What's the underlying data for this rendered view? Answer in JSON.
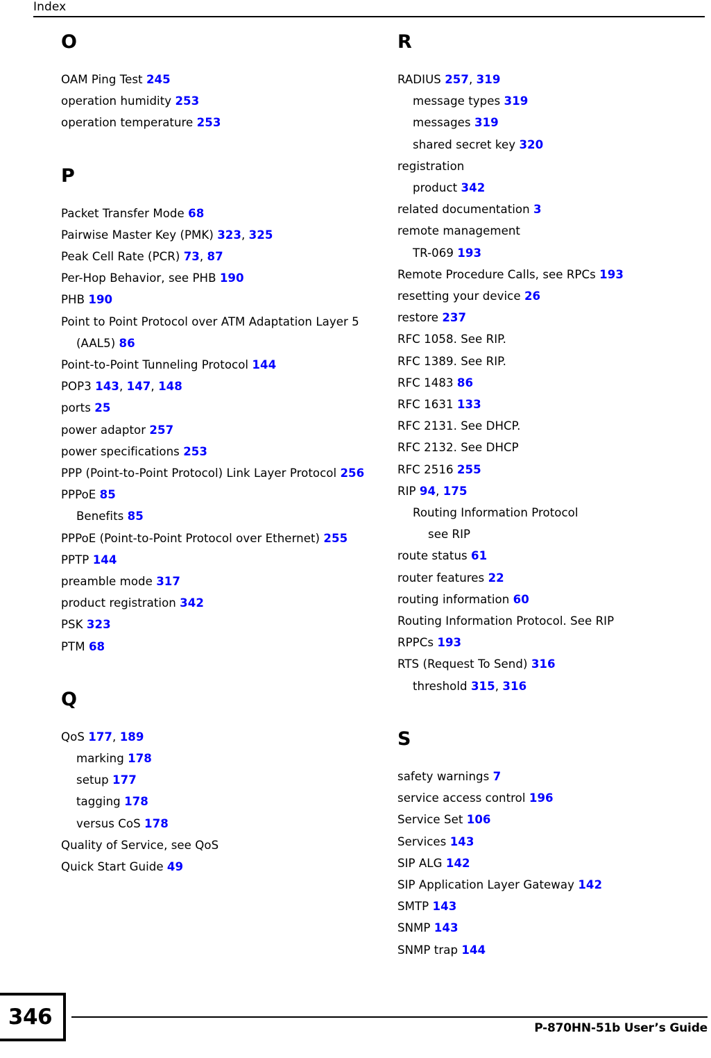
{
  "header": {
    "title": "Index"
  },
  "footer": {
    "page_number": "346",
    "guide_title": "P-870HN-51b User’s Guide"
  },
  "colors": {
    "page_reference": "#0000ff",
    "text": "#000000",
    "background": "#ffffff"
  },
  "columns": [
    {
      "name": "left",
      "sections": [
        {
          "letter": "O",
          "entries": [
            {
              "level": 0,
              "text": "OAM Ping Test ",
              "pages": [
                "245"
              ]
            },
            {
              "level": 0,
              "text": "operation humidity ",
              "pages": [
                "253"
              ]
            },
            {
              "level": 0,
              "text": "operation temperature ",
              "pages": [
                "253"
              ]
            }
          ]
        },
        {
          "letter": "P",
          "entries": [
            {
              "level": 0,
              "text": "Packet Transfer Mode ",
              "pages": [
                "68"
              ]
            },
            {
              "level": 0,
              "text": "Pairwise Master Key (PMK) ",
              "pages": [
                "323",
                "325"
              ]
            },
            {
              "level": 0,
              "text": "Peak Cell Rate (PCR) ",
              "pages": [
                "73",
                "87"
              ]
            },
            {
              "level": 0,
              "text": "Per-Hop Behavior, see PHB ",
              "pages": [
                "190"
              ]
            },
            {
              "level": 0,
              "text": "PHB ",
              "pages": [
                "190"
              ]
            },
            {
              "level": 0,
              "text": "Point to Point Protocol over ATM Adaptation Layer 5 (AAL5) ",
              "pages": [
                "86"
              ]
            },
            {
              "level": 0,
              "text": "Point-to-Point Tunneling Protocol ",
              "pages": [
                "144"
              ]
            },
            {
              "level": 0,
              "text": "POP3 ",
              "pages": [
                "143",
                "147",
                "148"
              ]
            },
            {
              "level": 0,
              "text": "ports ",
              "pages": [
                "25"
              ]
            },
            {
              "level": 0,
              "text": "power adaptor ",
              "pages": [
                "257"
              ]
            },
            {
              "level": 0,
              "text": "power specifications ",
              "pages": [
                "253"
              ]
            },
            {
              "level": 0,
              "text": "PPP (Point-to-Point Protocol) Link Layer Protocol ",
              "pages": [
                "256"
              ]
            },
            {
              "level": 0,
              "text": "PPPoE ",
              "pages": [
                "85"
              ]
            },
            {
              "level": 1,
              "text": "Benefits ",
              "pages": [
                "85"
              ]
            },
            {
              "level": 0,
              "text": "PPPoE (Point-to-Point Protocol over Ethernet) ",
              "pages": [
                "255"
              ]
            },
            {
              "level": 0,
              "text": "PPTP ",
              "pages": [
                "144"
              ]
            },
            {
              "level": 0,
              "text": "preamble mode ",
              "pages": [
                "317"
              ]
            },
            {
              "level": 0,
              "text": "product registration ",
              "pages": [
                "342"
              ]
            },
            {
              "level": 0,
              "text": "PSK ",
              "pages": [
                "323"
              ]
            },
            {
              "level": 0,
              "text": "PTM ",
              "pages": [
                "68"
              ]
            }
          ]
        },
        {
          "letter": "Q",
          "entries": [
            {
              "level": 0,
              "text": "QoS ",
              "pages": [
                "177",
                "189"
              ]
            },
            {
              "level": 1,
              "text": "marking ",
              "pages": [
                "178"
              ]
            },
            {
              "level": 1,
              "text": "setup ",
              "pages": [
                "177"
              ]
            },
            {
              "level": 1,
              "text": "tagging ",
              "pages": [
                "178"
              ]
            },
            {
              "level": 1,
              "text": "versus CoS ",
              "pages": [
                "178"
              ]
            },
            {
              "level": 0,
              "text": "Quality of Service, see QoS",
              "pages": []
            },
            {
              "level": 0,
              "text": "Quick Start Guide ",
              "pages": [
                "49"
              ]
            }
          ]
        }
      ]
    },
    {
      "name": "right",
      "sections": [
        {
          "letter": "R",
          "entries": [
            {
              "level": 0,
              "text": "RADIUS ",
              "pages": [
                "257",
                "319"
              ]
            },
            {
              "level": 1,
              "text": "message types ",
              "pages": [
                "319"
              ]
            },
            {
              "level": 1,
              "text": "messages ",
              "pages": [
                "319"
              ]
            },
            {
              "level": 1,
              "text": "shared secret key ",
              "pages": [
                "320"
              ]
            },
            {
              "level": 0,
              "text": "registration",
              "pages": []
            },
            {
              "level": 1,
              "text": "product ",
              "pages": [
                "342"
              ]
            },
            {
              "level": 0,
              "text": "related documentation ",
              "pages": [
                "3"
              ]
            },
            {
              "level": 0,
              "text": "remote management",
              "pages": []
            },
            {
              "level": 1,
              "text": "TR-069 ",
              "pages": [
                "193"
              ]
            },
            {
              "level": 0,
              "text": "Remote Procedure Calls, see RPCs ",
              "pages": [
                "193"
              ]
            },
            {
              "level": 0,
              "text": "resetting your device ",
              "pages": [
                "26"
              ]
            },
            {
              "level": 0,
              "text": "restore ",
              "pages": [
                "237"
              ]
            },
            {
              "level": 0,
              "text": "RFC 1058. See RIP.",
              "pages": []
            },
            {
              "level": 0,
              "text": "RFC 1389. See RIP.",
              "pages": []
            },
            {
              "level": 0,
              "text": "RFC 1483 ",
              "pages": [
                "86"
              ]
            },
            {
              "level": 0,
              "text": "RFC 1631 ",
              "pages": [
                "133"
              ]
            },
            {
              "level": 0,
              "text": "RFC 2131. See DHCP.",
              "pages": []
            },
            {
              "level": 0,
              "text": "RFC 2132. See DHCP",
              "pages": []
            },
            {
              "level": 0,
              "text": "RFC 2516 ",
              "pages": [
                "255"
              ]
            },
            {
              "level": 0,
              "text": "RIP ",
              "pages": [
                "94",
                "175"
              ]
            },
            {
              "level": 1,
              "text": "Routing Information Protocol",
              "pages": []
            },
            {
              "level": 2,
              "text": "see RIP",
              "pages": []
            },
            {
              "level": 0,
              "text": "route status ",
              "pages": [
                "61"
              ]
            },
            {
              "level": 0,
              "text": "router features ",
              "pages": [
                "22"
              ]
            },
            {
              "level": 0,
              "text": "routing information ",
              "pages": [
                "60"
              ]
            },
            {
              "level": 0,
              "text": "Routing Information Protocol. See RIP",
              "pages": []
            },
            {
              "level": 0,
              "text": "RPPCs ",
              "pages": [
                "193"
              ]
            },
            {
              "level": 0,
              "text": "RTS (Request To Send) ",
              "pages": [
                "316"
              ]
            },
            {
              "level": 1,
              "text": "threshold ",
              "pages": [
                "315",
                "316"
              ]
            }
          ]
        },
        {
          "letter": "S",
          "entries": [
            {
              "level": 0,
              "text": "safety warnings ",
              "pages": [
                "7"
              ]
            },
            {
              "level": 0,
              "text": "service access control ",
              "pages": [
                "196"
              ]
            },
            {
              "level": 0,
              "text": "Service Set ",
              "pages": [
                "106"
              ]
            },
            {
              "level": 0,
              "text": "Services ",
              "pages": [
                "143"
              ]
            },
            {
              "level": 0,
              "text": "SIP ALG ",
              "pages": [
                "142"
              ]
            },
            {
              "level": 0,
              "text": "SIP Application Layer Gateway ",
              "pages": [
                "142"
              ]
            },
            {
              "level": 0,
              "text": "SMTP ",
              "pages": [
                "143"
              ]
            },
            {
              "level": 0,
              "text": "SNMP ",
              "pages": [
                "143"
              ]
            },
            {
              "level": 0,
              "text": "SNMP trap ",
              "pages": [
                "144"
              ]
            }
          ]
        }
      ]
    }
  ]
}
